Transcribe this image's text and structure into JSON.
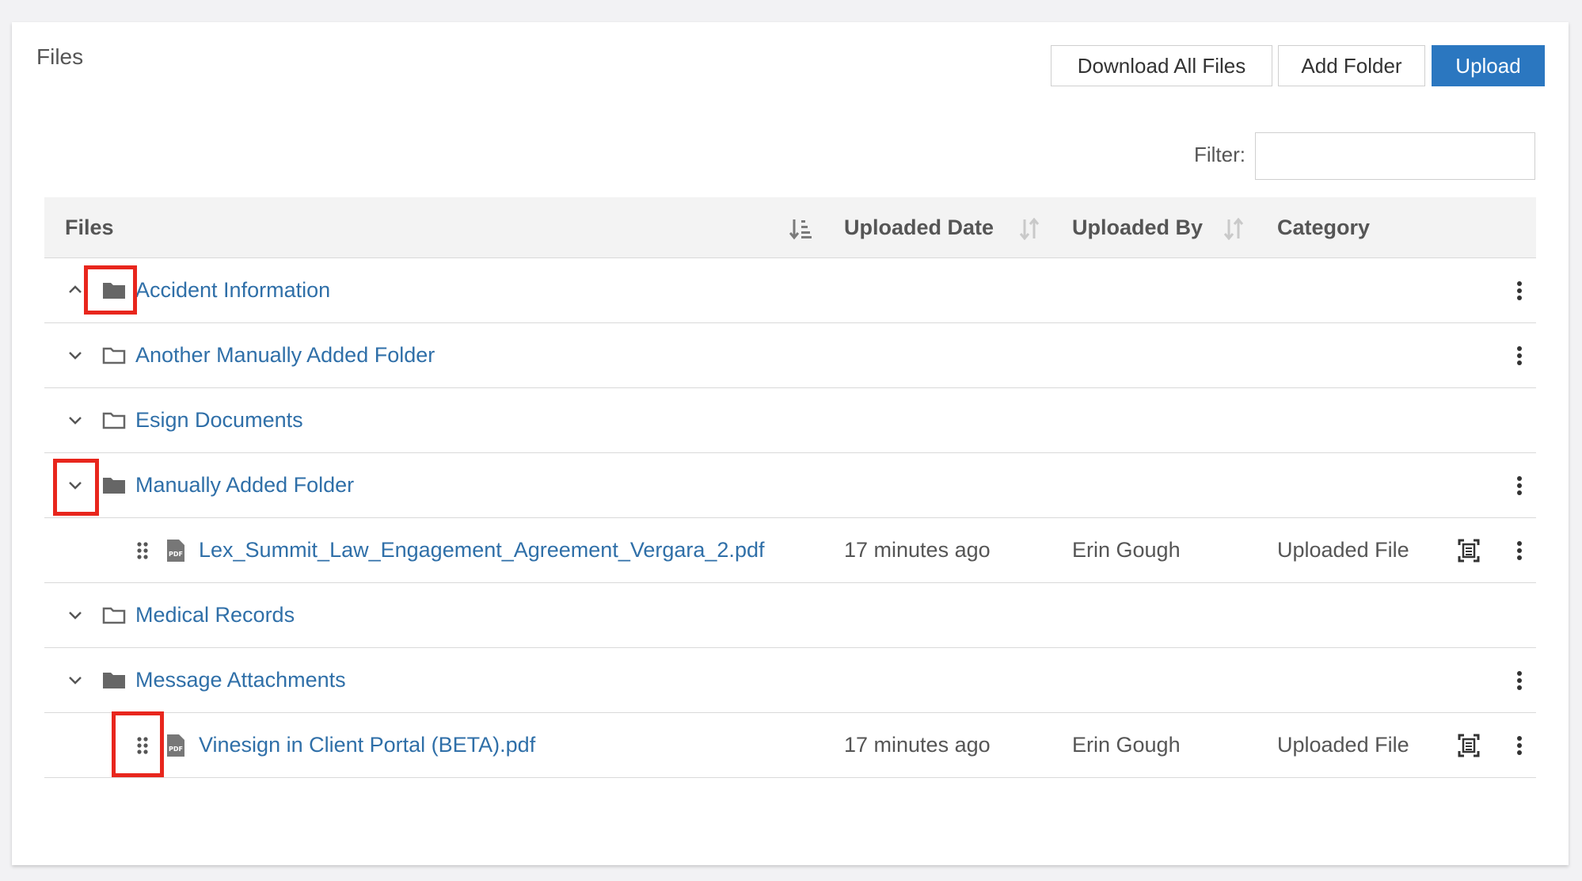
{
  "panel": {
    "title": "Files"
  },
  "toolbar": {
    "download_all_label": "Download All Files",
    "add_folder_label": "Add Folder",
    "upload_label": "Upload"
  },
  "filter": {
    "label": "Filter:",
    "value": ""
  },
  "table": {
    "headers": {
      "files": "Files",
      "uploaded_date": "Uploaded Date",
      "uploaded_by": "Uploaded By",
      "category": "Category"
    },
    "rows": [
      {
        "type": "folder",
        "name": "Accident Information",
        "expanded": true,
        "folder_icon": "folder-filled-icon"
      },
      {
        "type": "folder",
        "name": "Another Manually Added Folder",
        "expanded": false,
        "folder_icon": "folder-outline-icon"
      },
      {
        "type": "folder",
        "name": "Esign Documents",
        "expanded": false,
        "folder_icon": "folder-outline-icon"
      },
      {
        "type": "folder",
        "name": "Manually Added Folder",
        "expanded": false,
        "folder_icon": "folder-filled-icon"
      },
      {
        "type": "file",
        "name": "Lex_Summit_Law_Engagement_Agreement_Vergara_2.pdf",
        "uploaded_date": "17 minutes ago",
        "uploaded_by": "Erin Gough",
        "category": "Uploaded File"
      },
      {
        "type": "folder",
        "name": "Medical Records",
        "expanded": false,
        "folder_icon": "folder-outline-icon"
      },
      {
        "type": "folder",
        "name": "Message Attachments",
        "expanded": false,
        "folder_icon": "folder-filled-icon"
      },
      {
        "type": "file",
        "name": "Vinesign in Client Portal (BETA).pdf",
        "uploaded_date": "17 minutes ago",
        "uploaded_by": "Erin Gough",
        "category": "Uploaded File"
      }
    ]
  },
  "colors": {
    "link": "#2f6fa8",
    "primary_button": "#2b77c0",
    "highlight": "#e8261d"
  }
}
